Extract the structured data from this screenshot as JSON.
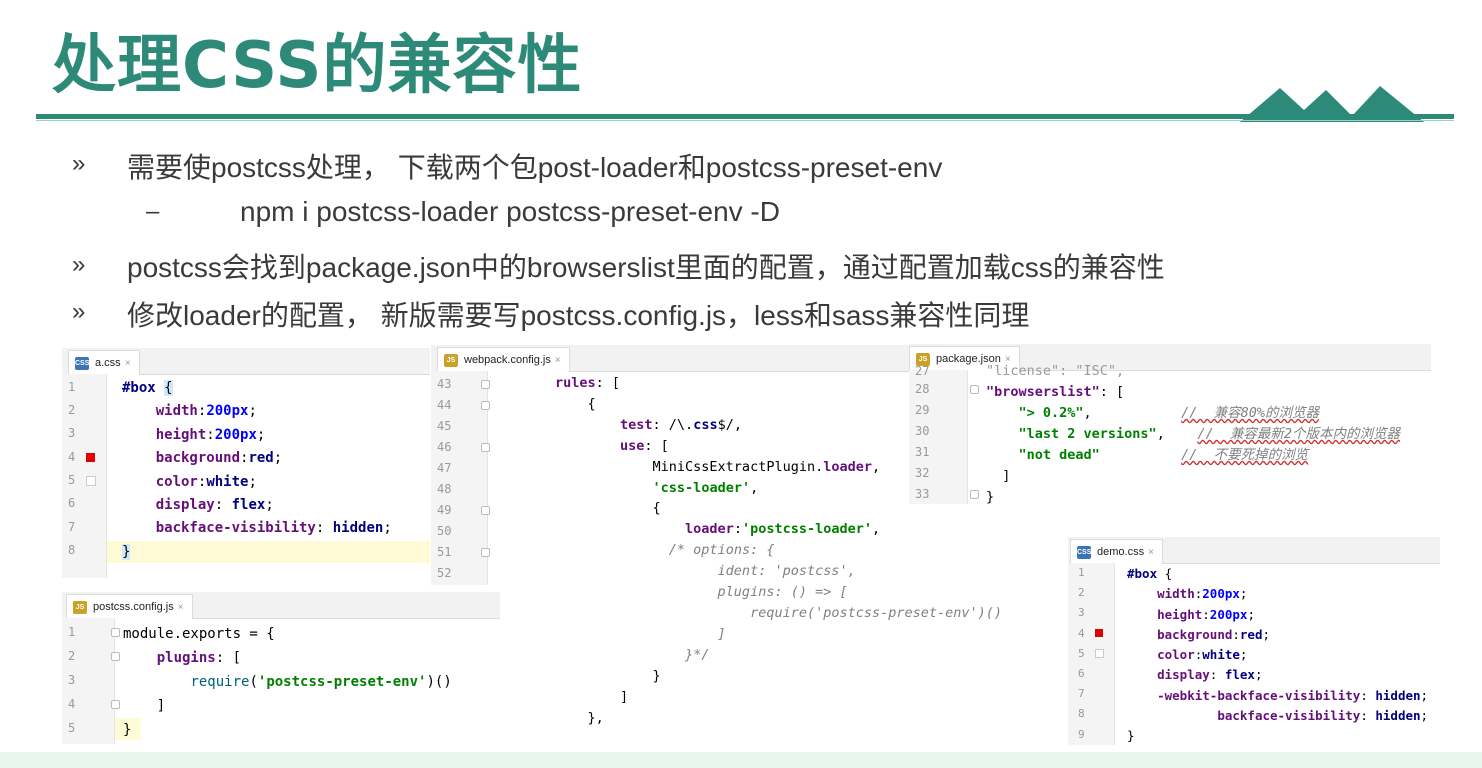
{
  "title": "处理CSS的兼容性",
  "colors": {
    "accent": "#2e8a78"
  },
  "bullets": [
    {
      "mark": "»",
      "text": "需要使postcss处理， 下载两个包post-loader和postcss-preset-env"
    },
    {
      "mark": "–",
      "text": "npm i postcss-loader postcss-preset-env -D"
    },
    {
      "mark": "»",
      "text": "postcss会找到package.json中的browserslist里面的配置，通过配置加载css的兼容性"
    },
    {
      "mark": "»",
      "text": "修改loader的配置， 新版需要写postcss.config.js，less和sass兼容性同理"
    }
  ],
  "editors": {
    "a_css": {
      "tab": "a.css",
      "icon": "CSS",
      "close": "×",
      "line_numbers": [
        "1",
        "2",
        "3",
        "4",
        "5",
        "6",
        "7",
        "8"
      ]
    },
    "webpack": {
      "tab": "webpack.config.js",
      "icon": "JS",
      "close": "×",
      "line_numbers": [
        "43",
        "44",
        "45",
        "46",
        "47",
        "48",
        "49",
        "50",
        "51",
        "52"
      ]
    },
    "package": {
      "tab": "package.json",
      "icon": "JS",
      "close": "×",
      "line_numbers": [
        "27",
        "28",
        "29",
        "30",
        "31",
        "32",
        "33"
      ]
    },
    "postcss_config": {
      "tab": "postcss.config.js",
      "icon": "JS",
      "close": "×",
      "line_numbers": [
        "1",
        "2",
        "3",
        "4",
        "5"
      ]
    },
    "demo_css": {
      "tab": "demo.css",
      "icon": "CSS",
      "close": "×",
      "line_numbers": [
        "1",
        "2",
        "3",
        "4",
        "5",
        "6",
        "7",
        "8",
        "9"
      ]
    }
  }
}
